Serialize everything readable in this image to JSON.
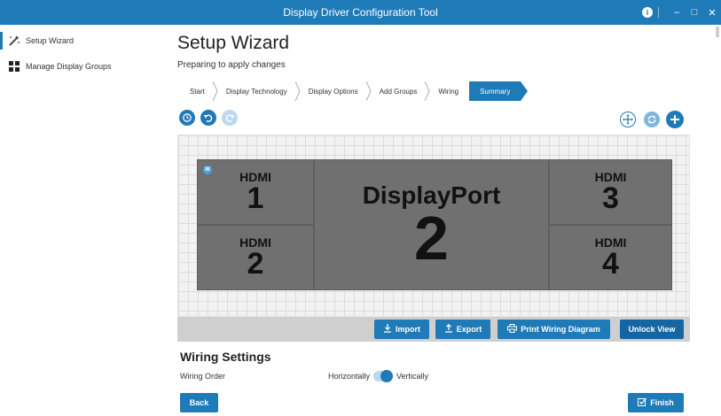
{
  "window": {
    "title": "Display Driver Configuration Tool",
    "controls": {
      "info": "i",
      "minimize": "–",
      "maximize": "□",
      "close": "✕"
    }
  },
  "sidebar": {
    "items": [
      {
        "label": "Setup Wizard",
        "icon": "magic-wand-icon",
        "active": true
      },
      {
        "label": "Manage Display Groups",
        "icon": "grid-icon",
        "active": false
      }
    ]
  },
  "header": {
    "title": "Setup Wizard",
    "subtitle": "Preparing to apply changes"
  },
  "steps": [
    {
      "label": "Start"
    },
    {
      "label": "Display Technology"
    },
    {
      "label": "Display Options"
    },
    {
      "label": "Add Groups"
    },
    {
      "label": "Wiring"
    },
    {
      "label": "Summary",
      "active": true
    }
  ],
  "toolbar": {
    "left": [
      "history-icon",
      "undo-icon",
      "redo-icon"
    ],
    "right": [
      "move-icon",
      "rotate-icon",
      "add-icon"
    ]
  },
  "displays": [
    {
      "label": "HDMI",
      "number": "1"
    },
    {
      "label": "DisplayPort",
      "number": "2"
    },
    {
      "label": "HDMI",
      "number": "3"
    },
    {
      "label": "HDMI",
      "number": "2"
    },
    {
      "label": "HDMI",
      "number": "4"
    }
  ],
  "badge": "W",
  "actions": {
    "import": "Import",
    "export": "Export",
    "print": "Print Wiring Diagram",
    "unlock": "Unlock View"
  },
  "wiring": {
    "title": "Wiring Settings",
    "order_label": "Wiring Order",
    "option_left": "Horizontally",
    "option_right": "Vertically",
    "selected": "Vertically"
  },
  "footer": {
    "back": "Back",
    "finish": "Finish"
  },
  "colors": {
    "accent": "#1f7ab8",
    "panel": "#707070",
    "canvas": "#f2f2f2"
  }
}
